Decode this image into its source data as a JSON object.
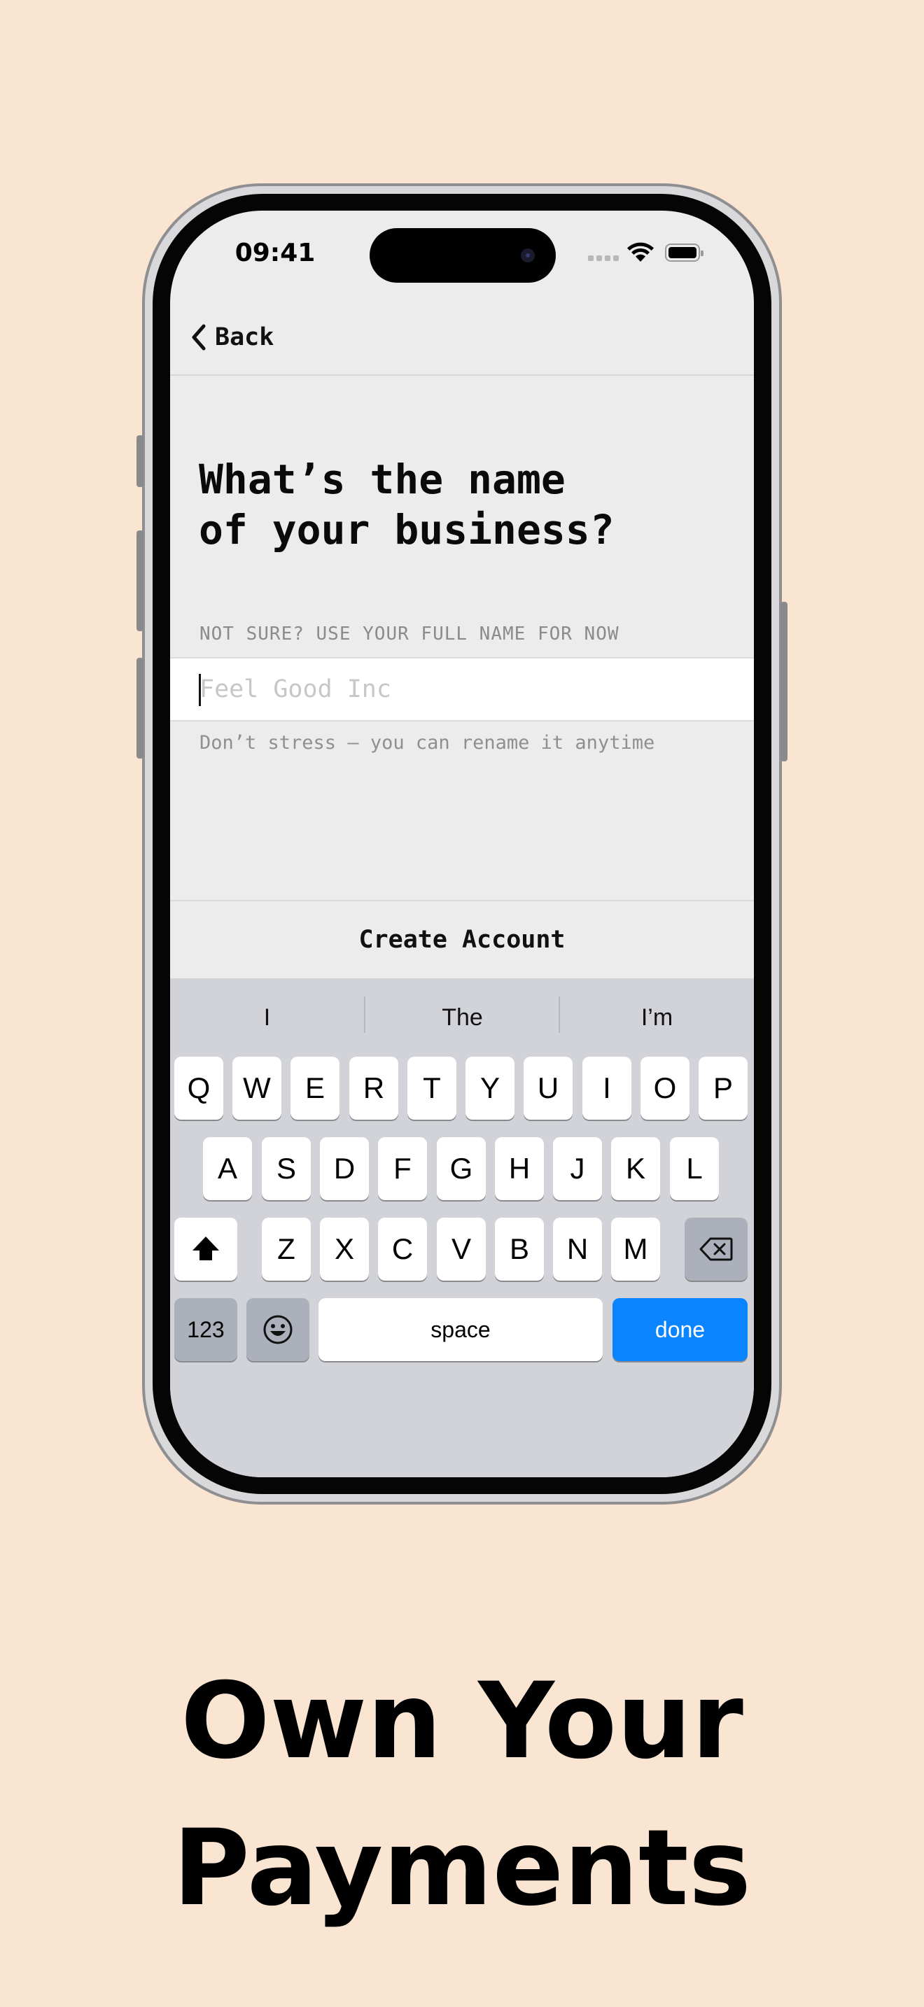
{
  "status_bar": {
    "time": "09:41"
  },
  "nav": {
    "back_label": "Back"
  },
  "screen": {
    "title": "What’s the name\nof your business?",
    "field_label": "NOT SURE? USE YOUR FULL NAME FOR NOW",
    "business_name": {
      "value": "",
      "placeholder": "Feel Good Inc"
    },
    "helper_text": "Don’t stress — you can rename it anytime",
    "cta_label": "Create Account"
  },
  "keyboard": {
    "suggestions": [
      "I",
      "The",
      "I’m"
    ],
    "row1": [
      "Q",
      "W",
      "E",
      "R",
      "T",
      "Y",
      "U",
      "I",
      "O",
      "P"
    ],
    "row2": [
      "A",
      "S",
      "D",
      "F",
      "G",
      "H",
      "J",
      "K",
      "L"
    ],
    "row3": [
      "Z",
      "X",
      "C",
      "V",
      "B",
      "N",
      "M"
    ],
    "numbers_label": "123",
    "space_label": "space",
    "done_label": "done",
    "accent_color": "#0a84ff"
  },
  "promo": {
    "headline": "Own Your\nPayments"
  },
  "background_color": "#fae5d3"
}
